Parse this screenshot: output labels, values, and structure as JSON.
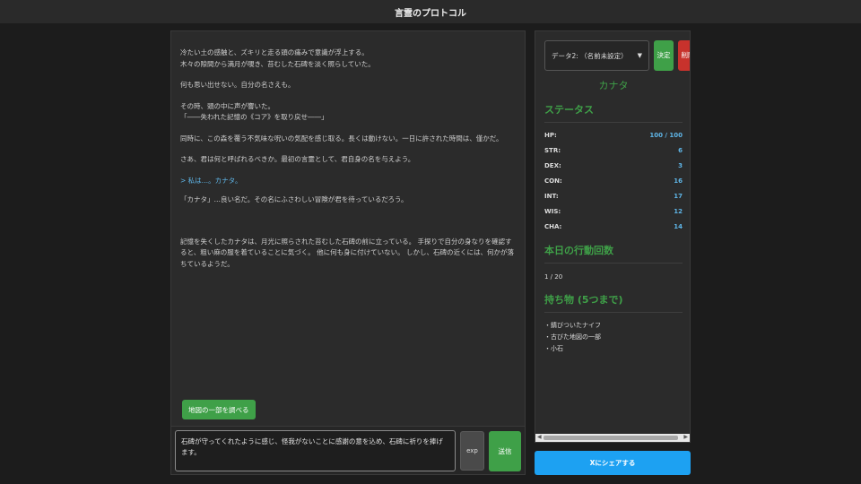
{
  "app": {
    "title": "言霊のプロトコル"
  },
  "story": {
    "paragraphs": [
      "冷たい土の感触と、ズキリと走る頭の痛みで意識が浮上する。\n木々の隙間から満月が覗き、苔むした石碑を淡く照らしていた。",
      "何も思い出せない。自分の名さえも。",
      "その時、頭の中に声が響いた。\n「――失われた記憶の《コア》を取り戻せ――」",
      "同時に、この森を覆う不気味な呪いの気配を感じ取る。長くは動けない。一日に許された時間は、僅かだ。",
      "さあ、君は何と呼ばれるべきか。最初の言霊として、君自身の名を与えよう。"
    ],
    "player_line": "> 私は…。カナタ。",
    "response": "「カナタ」…良い名だ。その名にふさわしい冒険が君を待っているだろう。",
    "narration": "記憶を失くしたカナタは、月光に照らされた苔むした石碑の前に立っている。 手探りで自分の身なりを確認すると、粗い麻の服を着ていることに気づく。 他に何も身に付けていない。 しかし、石碑の近くには、何かが落ちているようだ。"
  },
  "suggestion": {
    "label": "地図の一部を調べる"
  },
  "input": {
    "value": "石碑が守ってくれたように感じ、怪我がないことに感謝の意を込め、石碑に祈りを捧げます。"
  },
  "buttons": {
    "exp": "exp",
    "send": "送信",
    "decide": "決定",
    "delete": "削除",
    "share": "Xにシェアする"
  },
  "save_slot": {
    "selected": "データ2: （名前未設定）"
  },
  "character": {
    "name": "カナタ"
  },
  "status": {
    "title": "ステータス",
    "stats": [
      {
        "key": "HP:",
        "value": "100 / 100"
      },
      {
        "key": "STR:",
        "value": "6"
      },
      {
        "key": "DEX:",
        "value": "3"
      },
      {
        "key": "CON:",
        "value": "16"
      },
      {
        "key": "INT:",
        "value": "17"
      },
      {
        "key": "WIS:",
        "value": "12"
      },
      {
        "key": "CHA:",
        "value": "14"
      }
    ]
  },
  "actions": {
    "title": "本日の行動回数",
    "count": "1 / 20"
  },
  "inventory": {
    "title": "持ち物 (5つまで)",
    "items": [
      "・錆びついたナイフ",
      "・古びた地図の一部",
      "・小石"
    ]
  },
  "colors": {
    "accent": "#3fa048",
    "stat_value": "#5fb6e8",
    "danger": "#c8322c",
    "share": "#1da1f2"
  }
}
